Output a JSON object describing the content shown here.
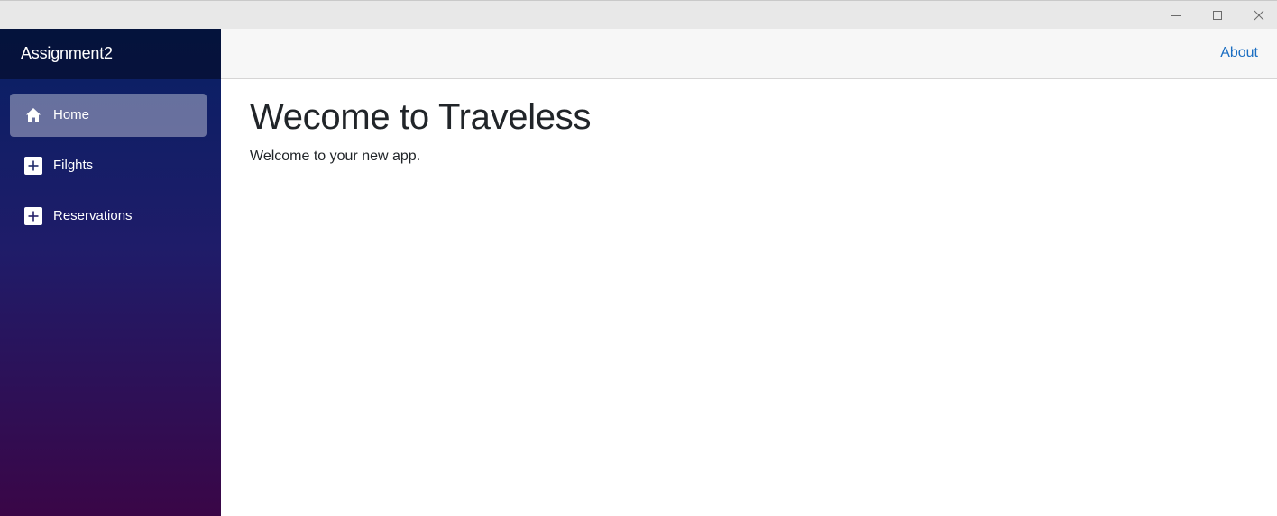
{
  "window": {
    "controls": {
      "minimize_icon": "minimize-icon",
      "maximize_icon": "maximize-icon",
      "close_icon": "close-icon"
    }
  },
  "sidebar": {
    "brand": "Assignment2",
    "items": [
      {
        "label": "Home",
        "icon": "home-icon",
        "active": true
      },
      {
        "label": "Filghts",
        "icon": "plus-icon",
        "active": false
      },
      {
        "label": "Reservations",
        "icon": "plus-icon",
        "active": false
      }
    ],
    "colors": {
      "gradient_top": "#072064",
      "gradient_bottom": "#3a0647"
    }
  },
  "top_row": {
    "about_label": "About",
    "link_color": "#1b6ec2"
  },
  "main": {
    "title": "Wecome to Traveless",
    "text": "Welcome to your new app."
  }
}
